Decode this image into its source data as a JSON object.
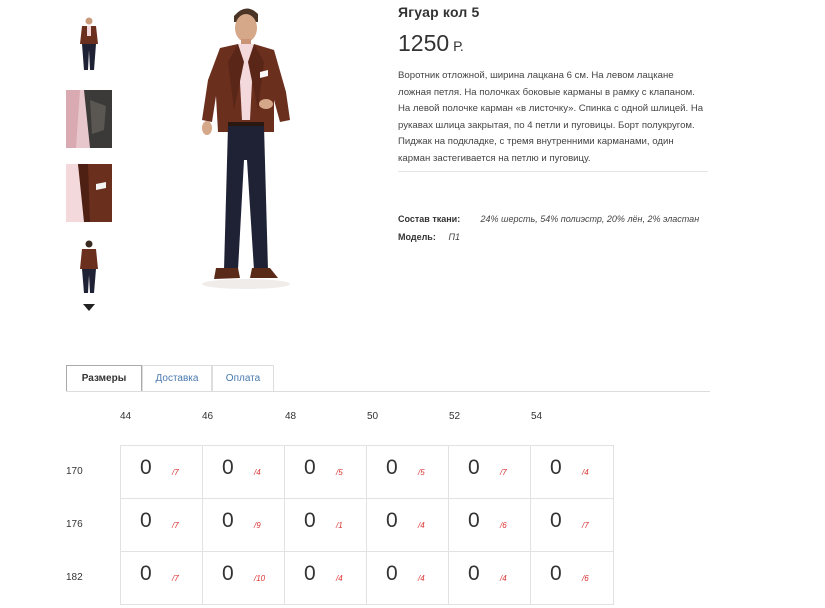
{
  "product": {
    "title": "Ягуар кол 5",
    "price_value": "1250",
    "price_currency": "Р.",
    "description": "Воротник отложной, ширина лацкана 6 см. На левом лацкане ложная петля. На полочках боковые карманы в рамку с клапаном. На левой полочке карман «в листочку». Спинка с одной шлицей. На рукавах шлица закрытая, по 4 петли и пуговицы. Борт полукругом. Пиджак на подкладке, с тремя внутренними карманами, один карман застегивается на петлю и пуговицу.",
    "specs": {
      "fabric_label": "Состав ткани:",
      "fabric_value": "24% шерсть, 54% полиэстр, 20% лён, 2% эластан",
      "model_label": "Модель:",
      "model_value": "П1"
    }
  },
  "gallery": {
    "thumbnails": [
      "thumb-full-front",
      "thumb-lining-detail",
      "thumb-chest-detail",
      "thumb-full-back"
    ],
    "arrow_icon": "chevron-down-icon"
  },
  "tabs": [
    {
      "label": "Размеры",
      "active": true
    },
    {
      "label": "Доставка",
      "active": false
    },
    {
      "label": "Оплата",
      "active": false
    }
  ],
  "sizes": {
    "columns": [
      "44",
      "46",
      "48",
      "50",
      "52",
      "54"
    ],
    "rows": [
      {
        "height": "170",
        "cells": [
          {
            "qty": "0",
            "num": "/7"
          },
          {
            "qty": "0",
            "num": "/4"
          },
          {
            "qty": "0",
            "num": "/5"
          },
          {
            "qty": "0",
            "num": "/5"
          },
          {
            "qty": "0",
            "num": "/7"
          },
          {
            "qty": "0",
            "num": "/4"
          }
        ]
      },
      {
        "height": "176",
        "cells": [
          {
            "qty": "0",
            "num": "/7"
          },
          {
            "qty": "0",
            "num": "/9"
          },
          {
            "qty": "0",
            "num": "/1"
          },
          {
            "qty": "0",
            "num": "/4"
          },
          {
            "qty": "0",
            "num": "/6"
          },
          {
            "qty": "0",
            "num": "/7"
          }
        ]
      },
      {
        "height": "182",
        "cells": [
          {
            "qty": "0",
            "num": "/7"
          },
          {
            "qty": "0",
            "num": "/10"
          },
          {
            "qty": "0",
            "num": "/4"
          },
          {
            "qty": "0",
            "num": "/4"
          },
          {
            "qty": "0",
            "num": "/4"
          },
          {
            "qty": "0",
            "num": "/6"
          }
        ]
      }
    ]
  },
  "colors": {
    "jacket": "#6b2f1e",
    "trousers": "#1f2235",
    "shirt": "#f3d8dc",
    "link": "#4a7ab0",
    "accent_red": "#d33333"
  }
}
